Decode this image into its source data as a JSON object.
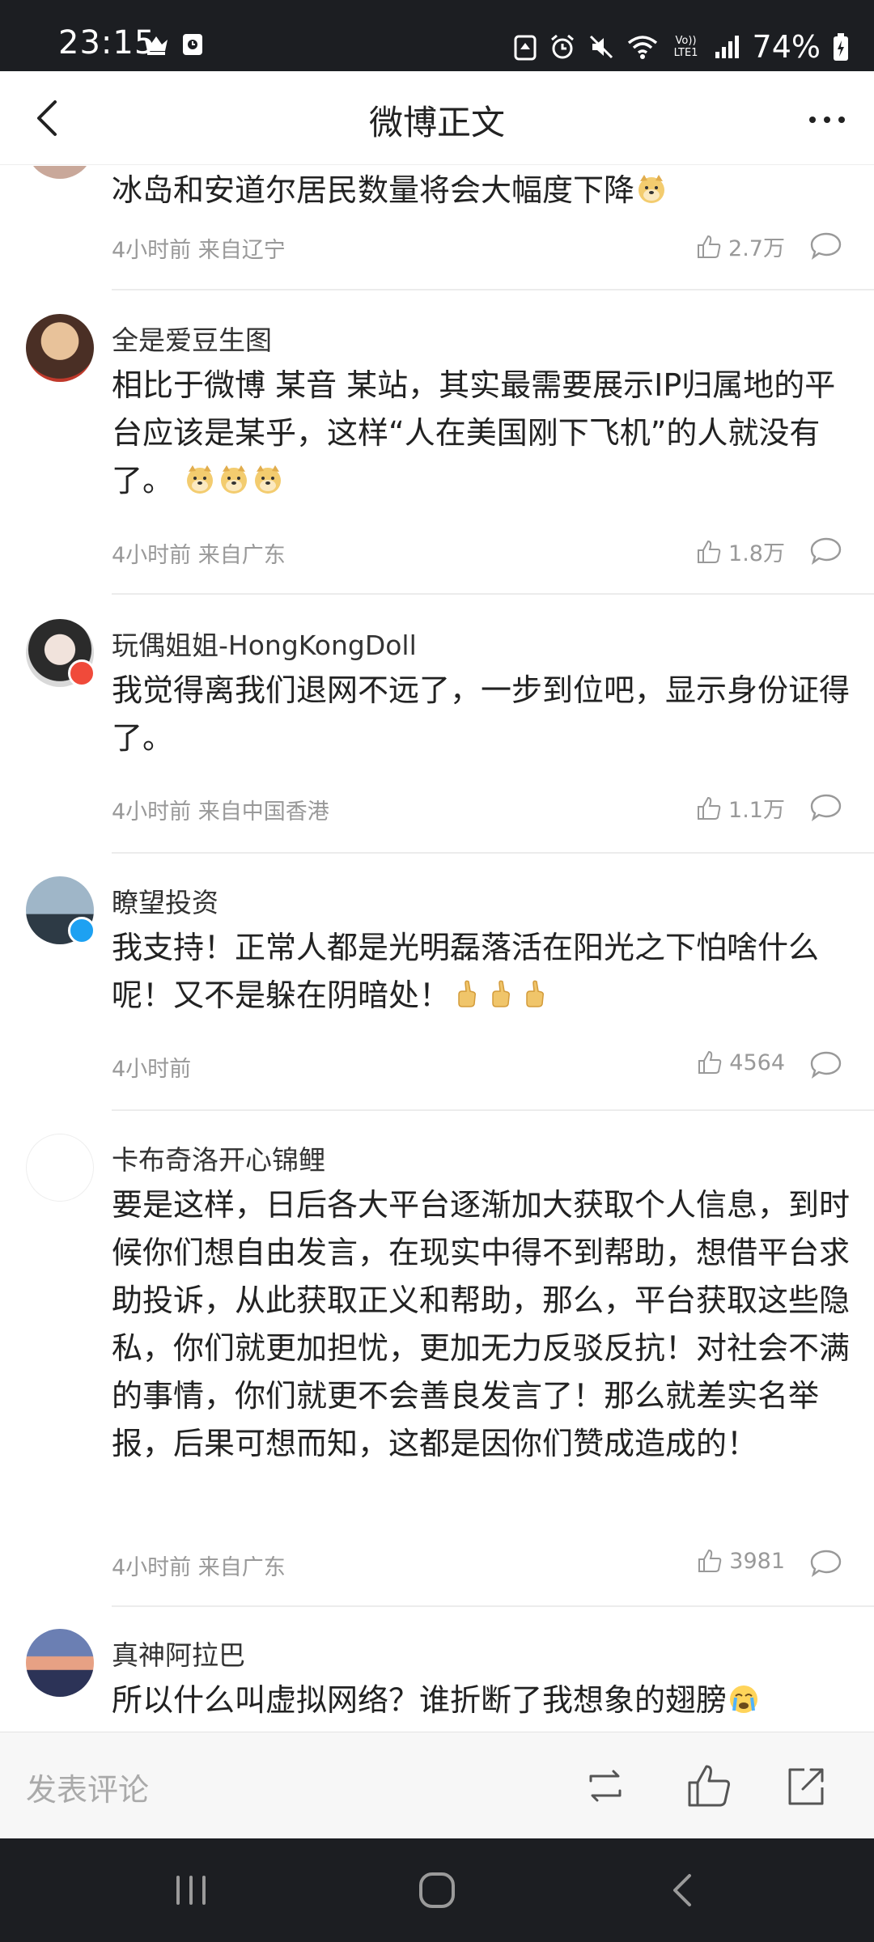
{
  "status_bar": {
    "time": "23:15",
    "battery": "74%",
    "icons": [
      "crown-icon",
      "card-icon",
      "recycle-icon",
      "alarm-icon",
      "mute-icon",
      "wifi-icon",
      "volte-icon",
      "signal-icon",
      "battery-icon"
    ],
    "volte_label": "Vo)) LTE1"
  },
  "header": {
    "title": "微博正文",
    "back_icon": "chevron-left-icon",
    "more_icon": "more-dots-icon"
  },
  "comments": [
    {
      "name": "",
      "text": "冰岛和安道尔居民数量将会大幅度下降",
      "emojis": [
        "doge"
      ],
      "time": "4小时前",
      "location": "来自辽宁",
      "likes": "2.7万"
    },
    {
      "name": "全是爱豆生图",
      "text": "相比于微博 某音 某站，其实最需要展示IP归属地的平台应该是某乎，这样“人在美国刚下飞机”的人就没有了。 ",
      "emojis": [
        "doge",
        "doge",
        "doge"
      ],
      "time": "4小时前",
      "location": "来自广东",
      "likes": "1.8万"
    },
    {
      "name": "玩偶姐姐-HongKongDoll",
      "text": "我觉得离我们退网不远了，一步到位吧，显示身份证得了。",
      "emojis": [],
      "time": "4小时前",
      "location": "来自中国香港",
      "likes": "1.1万"
    },
    {
      "name": "瞭望投资",
      "text": "我支持！正常人都是光明磊落活在阳光之下怕啥什么呢！又不是躲在阴暗处！",
      "emojis": [
        "thumbs-up",
        "thumbs-up",
        "thumbs-up"
      ],
      "time": "4小时前",
      "location": "",
      "likes": "4564"
    },
    {
      "name": "卡布奇洛开心锦鲤",
      "text": "要是这样，日后各大平台逐渐加大获取个人信息，到时候你们想自由发言，在现实中得不到帮助，想借平台求助投诉，从此获取正义和帮助，那么，平台获取这些隐私，你们就更加担忧，更加无力反驳反抗！对社会不满的事情，你们就更不会善良发言了！那么就差实名举报，后果可想而知，这都是因你们赞成造成的！",
      "emojis": [],
      "time": "4小时前",
      "location": "来自广东",
      "likes": "3981"
    },
    {
      "name": "真神阿拉巴",
      "text": "所以什么叫虚拟网络？谁折断了我想象的翅膀",
      "emojis": [
        "crying"
      ],
      "time": "",
      "location": "",
      "likes": ""
    }
  ],
  "bottom_bar": {
    "placeholder": "发表评论",
    "repost_icon": "repost-icon",
    "like_icon": "thumbs-up-icon",
    "share_icon": "share-icon"
  },
  "nav_bar": {
    "icons": [
      "recent-apps-icon",
      "home-icon",
      "back-icon"
    ]
  }
}
